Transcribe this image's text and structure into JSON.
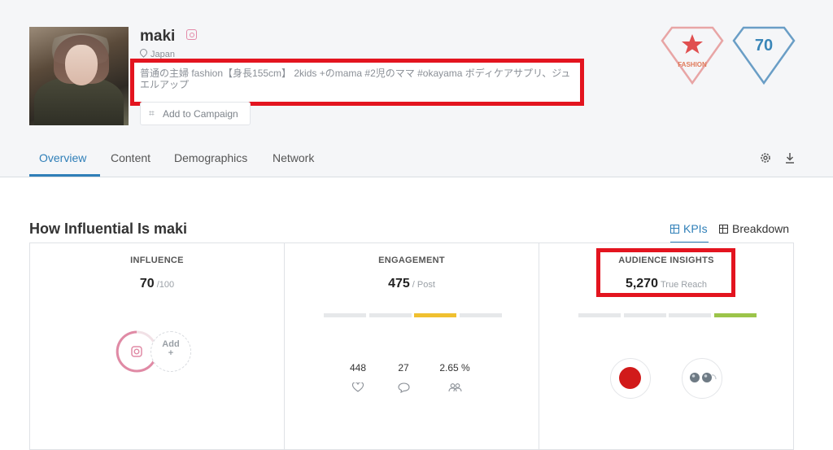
{
  "profile": {
    "name": "maki",
    "location": "Japan",
    "bio": "普通の主婦 fashion【身長155cm】 2kids +のmama #2児のママ #okayama ボディケアサプリ、ジュエルアップ",
    "campaign_label": "Add to Campaign"
  },
  "badges": {
    "category_label": "FASHION",
    "score": "70",
    "fashion_color": "#e07a7a",
    "score_color": "#3a86b8"
  },
  "tabs": [
    {
      "label": "Overview",
      "active": true
    },
    {
      "label": "Content",
      "active": false
    },
    {
      "label": "Demographics",
      "active": false
    },
    {
      "label": "Network",
      "active": false
    }
  ],
  "toolbar": {
    "settings_icon": "gear-icon",
    "download_icon": "download-icon"
  },
  "section": {
    "title": "How Influential Is maki",
    "kpis_label": "KPIs",
    "breakdown_label": "Breakdown"
  },
  "panels": {
    "influence": {
      "title": "INFLUENCE",
      "value": "70",
      "unit": "/100",
      "add_label": "Add",
      "add_plus": "+"
    },
    "engagement": {
      "title": "ENGAGEMENT",
      "value": "475",
      "unit": "/ Post",
      "level_segment": 3,
      "level_color": "#f0c030",
      "stats": [
        {
          "value": "448",
          "icon": "heart-icon"
        },
        {
          "value": "27",
          "icon": "comment-icon"
        },
        {
          "value": "2.65 %",
          "icon": "engagement-rate-icon"
        }
      ]
    },
    "audience": {
      "title": "AUDIENCE INSIGHTS",
      "value": "5,270",
      "unit": "True Reach",
      "level_segment": 4,
      "level_color": "#9cc44a"
    }
  },
  "colors": {
    "accent": "#2f7fb8",
    "highlight_red": "#e3141f",
    "instagram_pink": "#e38aa8"
  }
}
